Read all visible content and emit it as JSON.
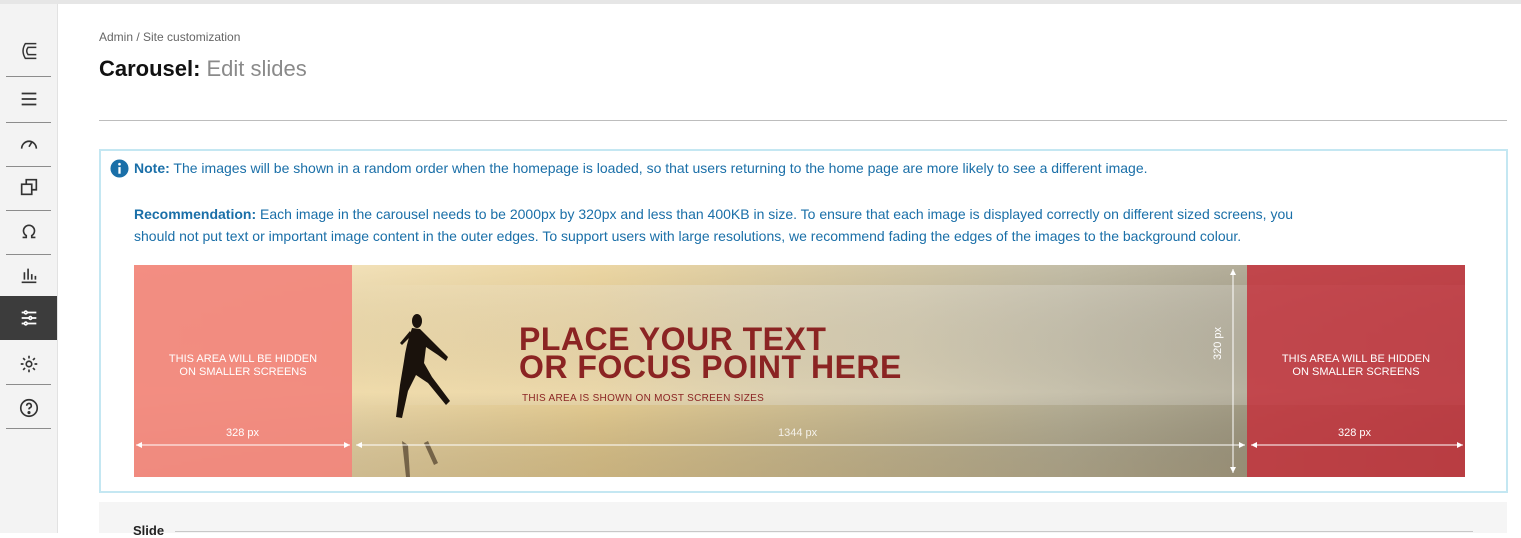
{
  "breadcrumb": "Admin / Site customization",
  "page_title": {
    "main": "Carousel:",
    "sub": "Edit slides"
  },
  "sidebar": {
    "items": [
      {
        "icon": "logo-icon"
      },
      {
        "icon": "menu-icon"
      },
      {
        "icon": "dashboard-gauge-icon"
      },
      {
        "icon": "copy-windows-icon"
      },
      {
        "icon": "omega-icon"
      },
      {
        "icon": "bar-chart-icon"
      },
      {
        "icon": "list-settings-icon",
        "active": true
      },
      {
        "icon": "gear-icon"
      },
      {
        "icon": "help-icon"
      }
    ]
  },
  "note": {
    "note_label": "Note:",
    "note_text": " The images will be shown in a random order when the homepage is loaded, so that users returning to the home page are more likely to see a different image.",
    "rec_label": "Recommendation:",
    "rec_text": " Each image in the carousel needs to be 2000px by 320px and less than 400KB in size. To ensure that each image is displayed correctly on different sized screens, you should not put text or important image content in the outer edges. To support users with large resolutions, we recommend fading the edges of the images to the background colour."
  },
  "banner": {
    "hidden_left": "THIS AREA WILL BE HIDDEN\nON SMALLER SCREENS",
    "hidden_right": "THIS AREA WILL BE HIDDEN\nON SMALLER SCREENS",
    "left_width": "328 px",
    "center_width": "1344 px",
    "right_width": "328 px",
    "height": "320 px",
    "headline_1": "PLACE YOUR TEXT",
    "headline_2": "OR FOCUS POINT HERE",
    "subline": "THIS AREA IS SHOWN ON MOST SCREEN SIZES"
  },
  "slide_section": {
    "label": "Slide"
  },
  "colors": {
    "accent": "#1a6fa8",
    "note_border": "#c4e7f2",
    "headline": "#8b2423"
  }
}
